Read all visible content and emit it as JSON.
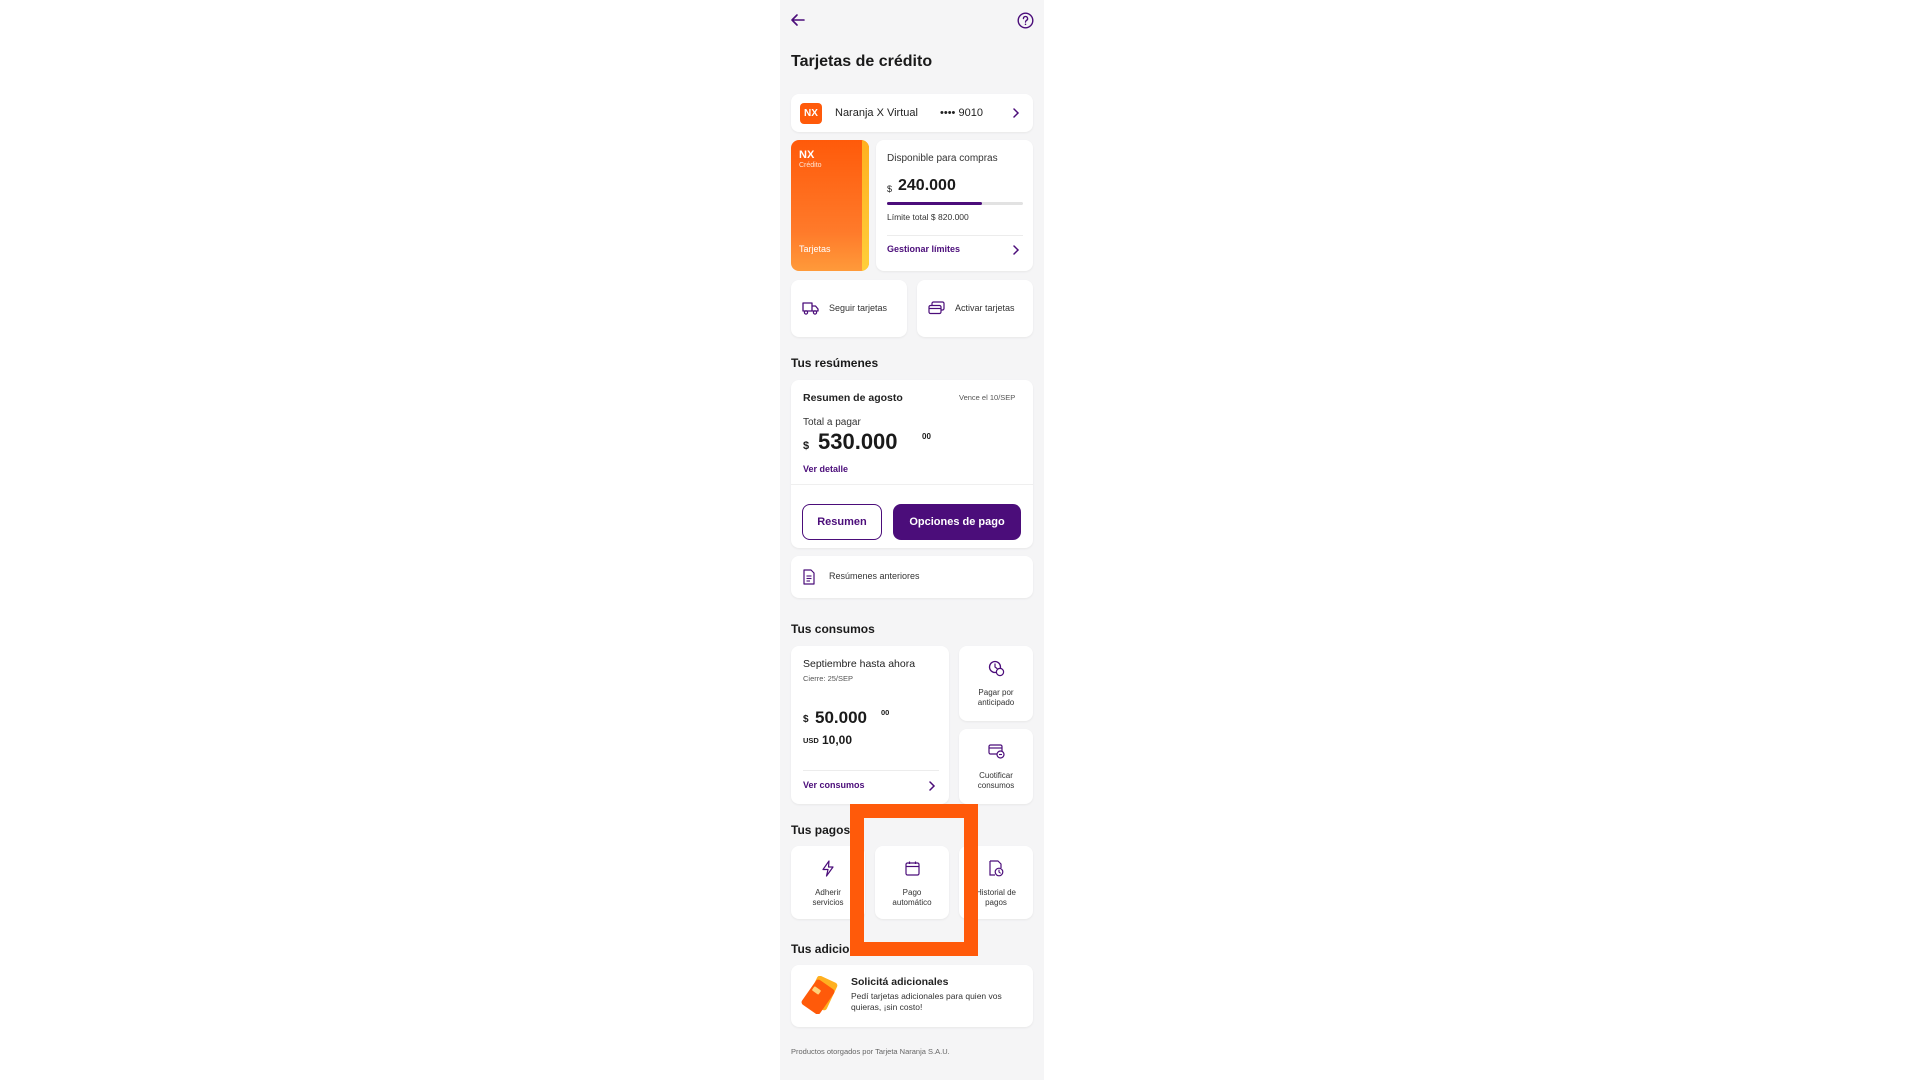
{
  "header": {
    "title": "Tarjetas de crédito"
  },
  "account": {
    "logo": "NX",
    "name": "Naranja X Virtual",
    "masked_number": "•••• 9010"
  },
  "credit_card": {
    "brand": "NX",
    "type": "Crédito",
    "label": "Tarjetas",
    "available_label": "Disponible para compras",
    "currency": "$",
    "available_amount": "240.000",
    "limit_text": "Límite total $ 820.000",
    "usage_fraction": 0.7,
    "manage_link": "Gestionar límites"
  },
  "actions": {
    "track": "Seguir tarjetas",
    "activate": "Activar tarjetas"
  },
  "summaries": {
    "section_title": "Tus resúmenes",
    "title": "Resumen de agosto",
    "due": "Vence el 10/SEP",
    "total_label": "Total a pagar",
    "currency": "$",
    "amount": "530.000",
    "cents": "00",
    "detail_link": "Ver detalle",
    "summary_button": "Resumen",
    "pay_options_button": "Opciones de pago",
    "previous": "Resúmenes anteriores"
  },
  "consumption": {
    "section_title": "Tus consumos",
    "title": "Septiembre hasta ahora",
    "closing": "Cierre: 25/SEP",
    "currency": "$",
    "amount": "50.000",
    "cents": "00",
    "usd_label": "USD",
    "usd_amount": "10,00",
    "link": "Ver consumos",
    "prepay_line1": "Pagar por",
    "prepay_line2": "anticipado",
    "installments_line1": "Cuotificar",
    "installments_line2": "consumos"
  },
  "payments": {
    "section_title": "Tus pagos",
    "services_line1": "Adherir",
    "services_line2": "servicios",
    "auto_line1": "Pago",
    "auto_line2": "automático",
    "history_line1": "Historial de",
    "history_line2": "pagos"
  },
  "additionals": {
    "section_title": "Tus adicionales",
    "title": "Solicitá adicionales",
    "description": "Pedí tarjetas adicionales para quien vos quieras, ¡sin costo!"
  },
  "footer": {
    "text": "Productos otorgados por Tarjeta Naranja S.A.U."
  },
  "colors": {
    "accent": "#4b0d7a",
    "brand_orange": "#ff5a0a",
    "highlight": "#ff5a0a"
  },
  "icons": {
    "back": "arrow-left-icon",
    "help": "help-circle-icon",
    "truck": "truck-icon",
    "cards": "cards-icon",
    "document": "document-icon",
    "prepay": "clock-coin-icon",
    "installments": "card-split-icon",
    "services": "lightning-icon",
    "auto_pay": "calendar-icon",
    "history": "receipt-clock-icon"
  }
}
